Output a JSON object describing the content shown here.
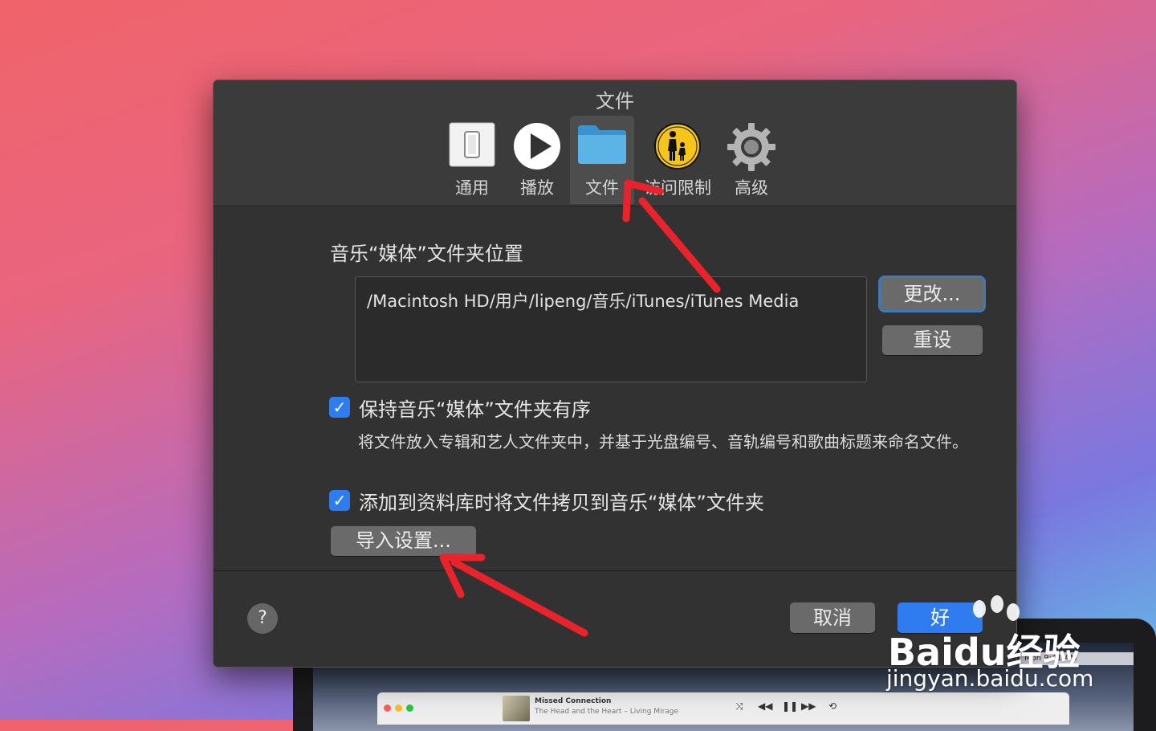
{
  "dialog": {
    "title": "文件",
    "tabs": [
      {
        "label": "通用",
        "icon": "general-switch-icon",
        "selected": false
      },
      {
        "label": "播放",
        "icon": "play-icon",
        "selected": false
      },
      {
        "label": "文件",
        "icon": "folder-icon",
        "selected": true
      },
      {
        "label": "访问限制",
        "icon": "parental-controls-icon",
        "selected": false
      },
      {
        "label": "高级",
        "icon": "gear-icon",
        "selected": false
      }
    ],
    "media_section_title": "音乐“媒体”文件夹位置",
    "media_path": "/Macintosh HD/用户/lipeng/音乐/iTunes/iTunes Media",
    "change_button": "更改...",
    "reset_button": "重设",
    "keep_organized": {
      "label": "保持音乐“媒体”文件夹有序",
      "checked": true
    },
    "keep_organized_desc": "将文件放入专辑和艺人文件夹中，并基于光盘编号、音轨编号和歌曲标题来命名文件。",
    "copy_to_media": {
      "label": "添加到资料库时将文件拷贝到音乐“媒体”文件夹",
      "checked": true
    },
    "import_settings_button": "导入设置...",
    "help_button": "?",
    "cancel_button": "取消",
    "ok_button": "好"
  },
  "background": {
    "menubar_clock": "Mon 9:41 AM",
    "player_song": "Missed Connection",
    "player_subtitle": "The Head and the Heart – Living Mirage"
  },
  "watermark": {
    "brand": "Baidu经验",
    "url": "jingyan.baidu.com"
  },
  "colors": {
    "accent": "#2f7bf0",
    "annotation_arrow": "#e8232b",
    "dialog_bg": "#323232"
  }
}
